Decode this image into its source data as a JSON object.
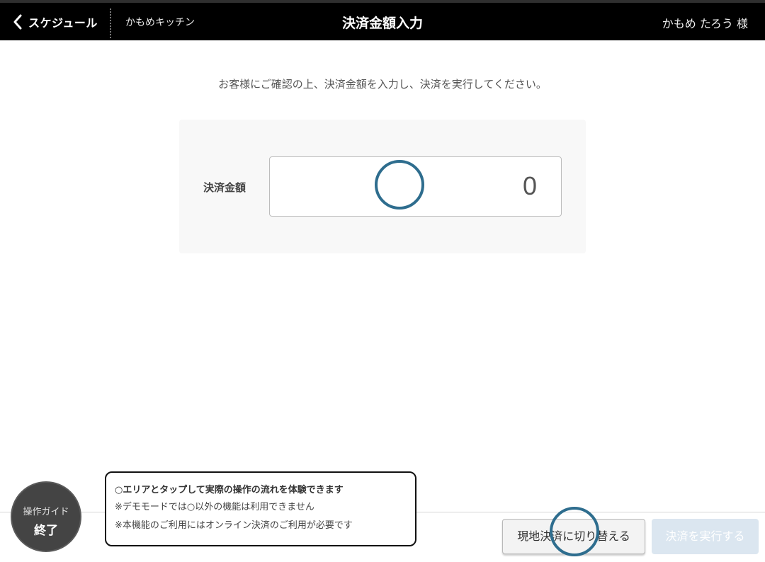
{
  "header": {
    "back_label": "スケジュール",
    "shop_name": "かもめキッチン",
    "title": "決済金額入力",
    "user_name": "かもめ たろう 様"
  },
  "main": {
    "instruction": "お客様にご確認の上、決済金額を入力し、決済を実行してください。",
    "amount_label": "決済金額",
    "amount_value": "0"
  },
  "guide": {
    "line1": "操作ガイド",
    "line2": "終了",
    "tooltip": {
      "line1": "○エリアとタップして実際の操作の流れを体験できます",
      "line2": "※デモモードでは○以外の機能は利用できません",
      "line3": "※本機能のご利用にはオンライン決済のご利用が必要です"
    }
  },
  "footer": {
    "switch_label": "現地決済に切り替える",
    "execute_label": "決済を実行する"
  },
  "icons": {
    "back": "chevron-left-icon",
    "highlight": "tap-highlight-ring"
  },
  "colors": {
    "header_bg": "#000000",
    "ring": "#2e6d8e",
    "execute_disabled_bg": "#dbe6f0"
  }
}
